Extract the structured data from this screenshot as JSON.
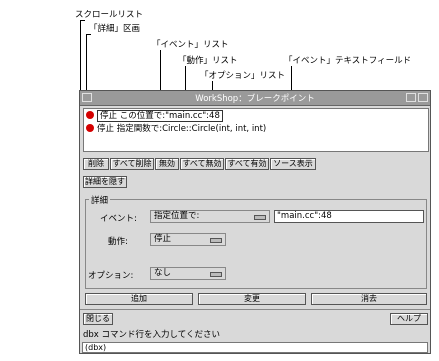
{
  "callouts": {
    "scroll_list": "スクロールリスト",
    "details_area": "「詳細」区画",
    "event_list": "「イベント」リスト",
    "action_list": "「動作」リスト",
    "option_list": "「オプション」リスト",
    "event_text_field": "「イベント」テキストフィールド"
  },
  "window": {
    "title": "WorkShop：ブレークポイント"
  },
  "breakpoints": [
    {
      "text": "停止 この位置で:\"main.cc\":48"
    },
    {
      "text": "停止 指定関数で:Circle::Circle(int, int, int)"
    }
  ],
  "toolbar": {
    "delete": "削除",
    "delete_all": "すべて削除",
    "disable": "無効",
    "disable_all": "すべて無効",
    "enable_all": "すべて有効",
    "source_display": "ソース表示"
  },
  "details_toggle": "詳細を隠す",
  "details": {
    "group_label": "詳細",
    "event_label": "イベント:",
    "event_value": "指定位置で:",
    "event_text": "\"main.cc\":48",
    "action_label": "動作:",
    "action_value": "停止",
    "option_label": "オプション:",
    "option_value": "なし"
  },
  "buttons": {
    "add": "追加",
    "change": "変更",
    "clear": "消去"
  },
  "bottom": {
    "close": "閉じる",
    "help": "ヘルプ"
  },
  "status": "dbx コマンド行を入力してください",
  "command": "(dbx)"
}
